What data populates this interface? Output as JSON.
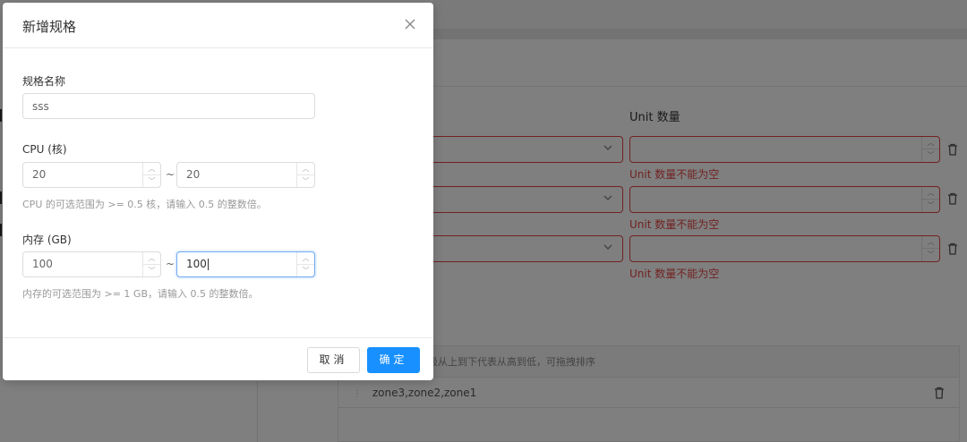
{
  "background": {
    "unit_label": "Unit 数量",
    "error_text": "Unit 数量不能为空",
    "rows": [
      {
        "error": "Unit 数量不能为空"
      },
      {
        "error": "Unit 数量不能为空"
      },
      {
        "error": "Unit 数量不能为空"
      }
    ],
    "zone_table": {
      "header_hint": "级从上到下代表从高到低，可拖拽排序",
      "row": "zone3,zone2,zone1"
    }
  },
  "modal": {
    "title": "新增规格",
    "name_label": "规格名称",
    "name_value": "sss",
    "cpu": {
      "label": "CPU (核)",
      "min": "20",
      "max": "20",
      "separator": "~",
      "hint": "CPU 的可选范围为 >= 0.5 核，请输入 0.5 的整数倍。"
    },
    "memory": {
      "label": "内存 (GB)",
      "min": "100",
      "max": "100",
      "separator": "~",
      "hint": "内存的可选范围为 >= 1 GB，请输入 0.5 的整数倍。"
    },
    "cancel_label": "取消",
    "ok_label": "确定"
  },
  "icons": {
    "close": "close-icon",
    "trash": "trash-icon",
    "chevron": "chevron-down-icon",
    "spinner": "stepper-arrows-icon"
  },
  "colors": {
    "primary": "#1890ff",
    "error": "#e54545",
    "active_border": "#6fa8f2"
  }
}
